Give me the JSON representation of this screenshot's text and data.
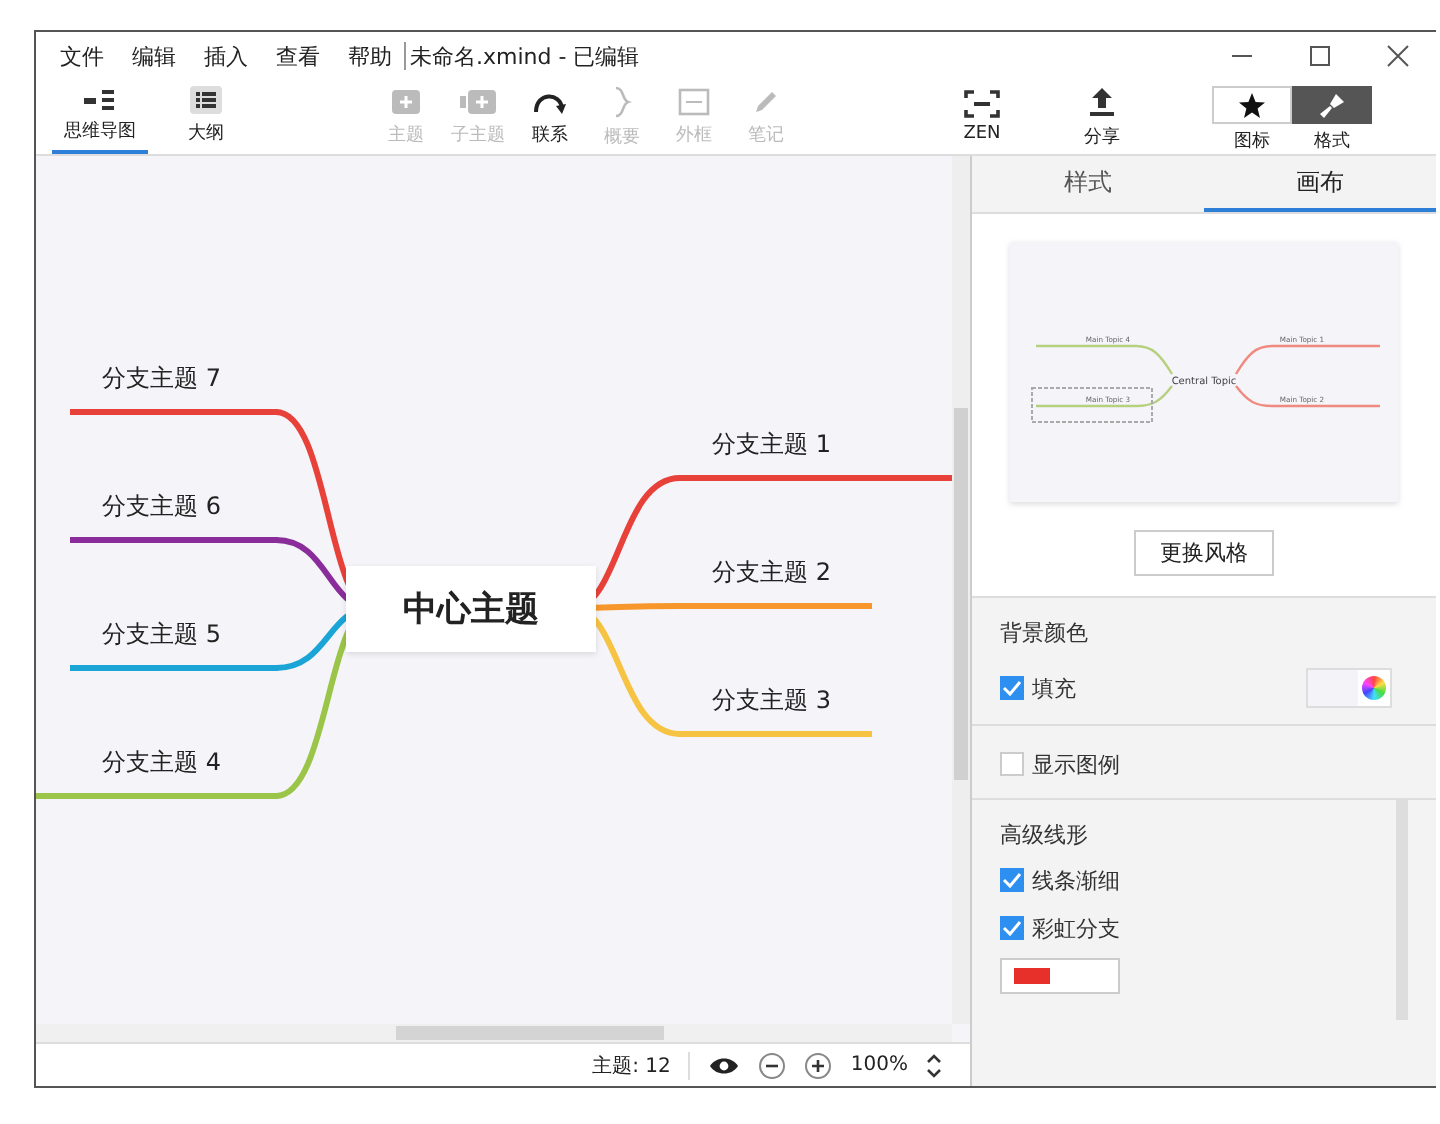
{
  "menu": [
    "文件",
    "编辑",
    "插入",
    "查看",
    "帮助"
  ],
  "title": "未命名.xmind - 已编辑",
  "view_tabs": [
    {
      "label": "思维导图",
      "selected": true,
      "kind": "map"
    },
    {
      "label": "大纲",
      "selected": false,
      "kind": "outline"
    }
  ],
  "tools": [
    {
      "label": "主题",
      "disabled": true,
      "kind": "topic"
    },
    {
      "label": "子主题",
      "disabled": true,
      "kind": "subtopic"
    },
    {
      "label": "联系",
      "disabled": false,
      "kind": "relation"
    },
    {
      "label": "概要",
      "disabled": true,
      "kind": "summary"
    },
    {
      "label": "外框",
      "disabled": true,
      "kind": "boundary"
    },
    {
      "label": "笔记",
      "disabled": true,
      "kind": "note"
    }
  ],
  "share_tools": [
    {
      "label": "ZEN",
      "kind": "zen"
    },
    {
      "label": "分享",
      "kind": "share"
    }
  ],
  "panel_toggles": [
    {
      "label": "图标",
      "selected": false,
      "kind": "star"
    },
    {
      "label": "格式",
      "selected": true,
      "kind": "brush"
    }
  ],
  "map": {
    "central": "中心主题",
    "left_branches": [
      {
        "label": "分支主题 7",
        "color": "#e8413a"
      },
      {
        "label": "分支主题 6",
        "color": "#8a2d9b"
      },
      {
        "label": "分支主题 5",
        "color": "#1aa5d6"
      },
      {
        "label": "分支主题 4",
        "color": "#9bc548"
      }
    ],
    "right_branches": [
      {
        "label": "分支主题 1",
        "color": "#e8413a"
      },
      {
        "label": "分支主题 2",
        "color": "#f7962b"
      },
      {
        "label": "分支主题 3",
        "color": "#f6c343"
      }
    ]
  },
  "panel": {
    "tabs": [
      {
        "label": "样式",
        "selected": false
      },
      {
        "label": "画布",
        "selected": true
      }
    ],
    "preview": {
      "central": "Central Topic",
      "topics": [
        "Main Topic 4",
        "Main Topic 1",
        "Main Topic 3",
        "Main Topic 2"
      ]
    },
    "change_style_button": "更换风格",
    "background": {
      "title": "背景颜色",
      "fill": {
        "label": "填充",
        "checked": true
      }
    },
    "legend": {
      "label": "显示图例",
      "checked": false
    },
    "advanced": {
      "title": "高级线形",
      "options": [
        {
          "label": "线条渐细",
          "checked": true
        },
        {
          "label": "彩虹分支",
          "checked": true
        }
      ]
    }
  },
  "status_bar": {
    "topic_count": "主题: 12",
    "zoom": "100%"
  }
}
